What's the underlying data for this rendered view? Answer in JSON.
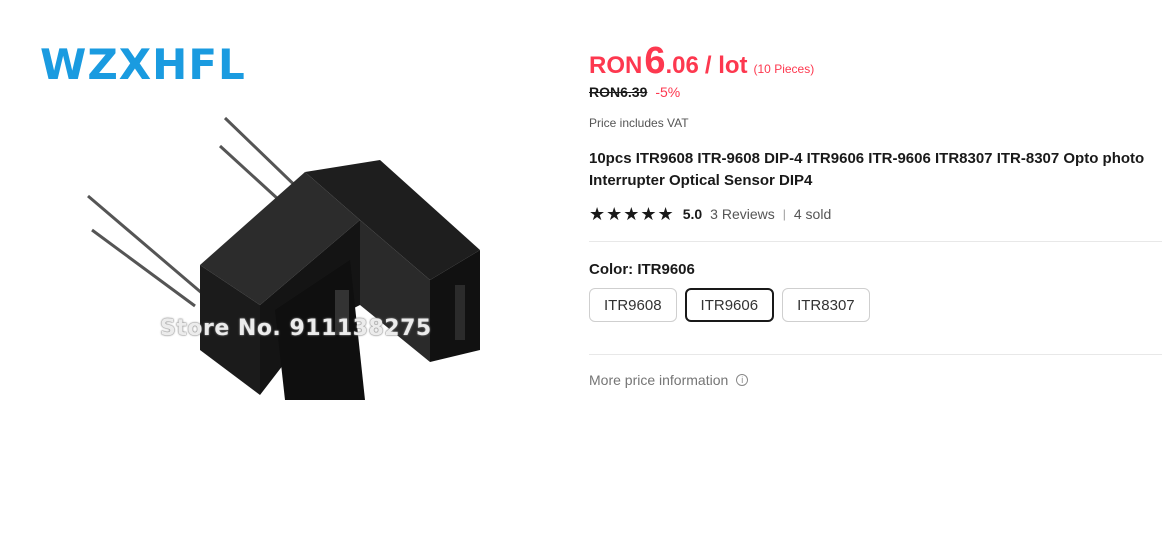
{
  "gallery": {
    "brand": "WZXHFL",
    "watermark": "Store No. 911138275",
    "brand_color": "#1a9be0"
  },
  "price": {
    "currency": "RON",
    "integer": "6",
    "decimal": ".06",
    "unit": "/ lot",
    "pieces": "(10 Pieces)",
    "original": "RON6.39",
    "discount": "-5%",
    "vat_note": "Price includes VAT",
    "color": "#fd384f"
  },
  "product": {
    "title": "10pcs ITR9608 ITR-9608 DIP-4 ITR9606 ITR-9606 ITR8307 ITR-8307 Opto photo Interrupter Optical Sensor DIP4",
    "stars": "★★★★★",
    "rating": "5.0",
    "reviews": "3 Reviews",
    "separator": "|",
    "sold": "4 sold"
  },
  "variants": {
    "label": "Color: ITR9606",
    "options": [
      "ITR9608",
      "ITR9606",
      "ITR8307"
    ],
    "selected": "ITR9606"
  },
  "more_price": {
    "label": "More price information",
    "icon": "info-icon"
  }
}
